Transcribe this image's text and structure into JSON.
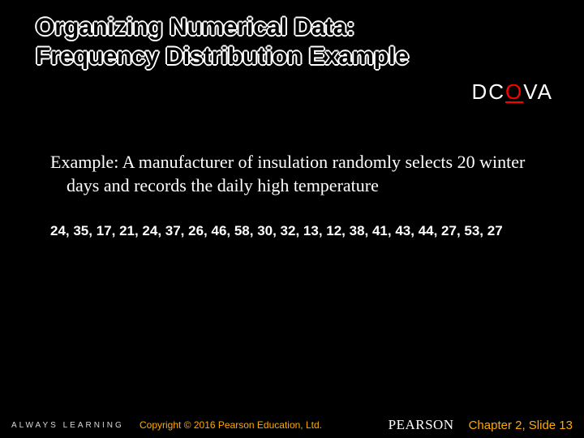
{
  "title": {
    "line1": "Organizing Numerical Data:",
    "line2": "Frequency Distribution Example"
  },
  "dcova": {
    "d": "D",
    "c": "C",
    "o": "O",
    "v": "V",
    "a": "A"
  },
  "example": {
    "text": "Example: A manufacturer of insulation randomly selects 20 winter days and records the daily high temperature"
  },
  "data_values": "24, 35, 17, 21, 24, 37, 26, 46, 58, 30, 32, 13, 12, 38, 41, 43, 44, 27, 53, 27",
  "footer": {
    "always_learning": "ALWAYS LEARNING",
    "copyright": "Copyright © 2016 Pearson Education, Ltd.",
    "pearson": "PEARSON",
    "slide": "Chapter 2, Slide 13"
  }
}
